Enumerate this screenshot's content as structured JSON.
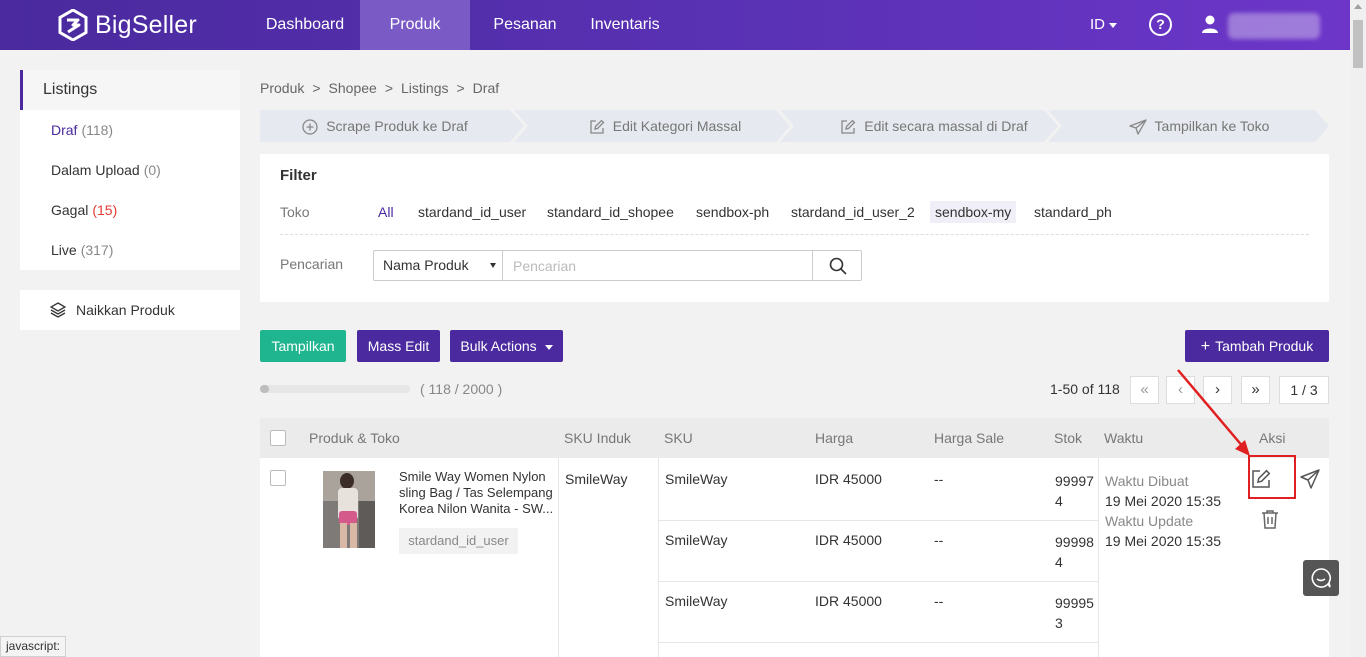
{
  "brand": {
    "name": "BigSeller"
  },
  "nav": {
    "items": [
      {
        "label": "Dashboard"
      },
      {
        "label": "Produk"
      },
      {
        "label": "Pesanan"
      },
      {
        "label": "Inventaris"
      }
    ],
    "lang": "ID"
  },
  "sidebar": {
    "title": "Listings",
    "items": [
      {
        "label": "Draf",
        "count": "(118)"
      },
      {
        "label": "Dalam Upload",
        "count": "(0)"
      },
      {
        "label": "Gagal",
        "count": "(15)"
      },
      {
        "label": "Live",
        "count": "(317)"
      }
    ],
    "bottom": "Naikkan Produk"
  },
  "breadcrumb": [
    "Produk",
    "Shopee",
    "Listings",
    "Draf"
  ],
  "steps": [
    {
      "label": "Scrape Produk ke Draf",
      "icon": "plus-circle-icon"
    },
    {
      "label": "Edit Kategori Massal",
      "icon": "edit-icon"
    },
    {
      "label": "Edit secara massal di Draf",
      "icon": "edit-icon"
    },
    {
      "label": "Tampilkan ke Toko",
      "icon": "send-icon"
    }
  ],
  "filter": {
    "title": "Filter",
    "store_label": "Toko",
    "stores": [
      "All",
      "stardand_id_user",
      "standard_id_shopee",
      "sendbox-ph",
      "stardand_id_user_2",
      "sendbox-my",
      "standard_ph"
    ],
    "search_label": "Pencarian",
    "search_select": "Nama Produk",
    "search_placeholder": "Pencarian"
  },
  "actions": {
    "show": "Tampilkan",
    "mass_edit": "Mass Edit",
    "bulk": "Bulk Actions",
    "add": "Tambah Produk"
  },
  "quota": {
    "text": "( 118 / 2000 )",
    "fraction": 0.059
  },
  "pager": {
    "range": "1-50 of 118",
    "page": "1 / 3"
  },
  "table": {
    "headers": {
      "product": "Produk & Toko",
      "parent_sku": "SKU Induk",
      "sku": "SKU",
      "price": "Harga",
      "sale_price": "Harga Sale",
      "stock": "Stok",
      "time": "Waktu",
      "action": "Aksi"
    },
    "row": {
      "name": "Smile Way Women Nylon sling Bag / Tas Selempang Korea Nilon Wanita - SW...",
      "store": "stardand_id_user",
      "parent_sku": "SmileWay",
      "created_label": "Waktu Dibuat",
      "created": "19 Mei 2020 15:35",
      "updated_label": "Waktu Update",
      "updated": "19 Mei 2020 15:35",
      "variants": [
        {
          "sku": "SmileWay",
          "price": "IDR 45000",
          "sale": "--",
          "stock_a": "99997",
          "stock_b": "4"
        },
        {
          "sku": "SmileWay",
          "price": "IDR 45000",
          "sale": "--",
          "stock_a": "99998",
          "stock_b": "4"
        },
        {
          "sku": "SmileWay",
          "price": "IDR 45000",
          "sale": "--",
          "stock_a": "99995",
          "stock_b": "3"
        }
      ]
    }
  },
  "statusbar": "javascript:",
  "colors": {
    "primary": "#4a2a9e",
    "green": "#1fb58f",
    "red": "#e53935",
    "annotation": "#e02020"
  }
}
